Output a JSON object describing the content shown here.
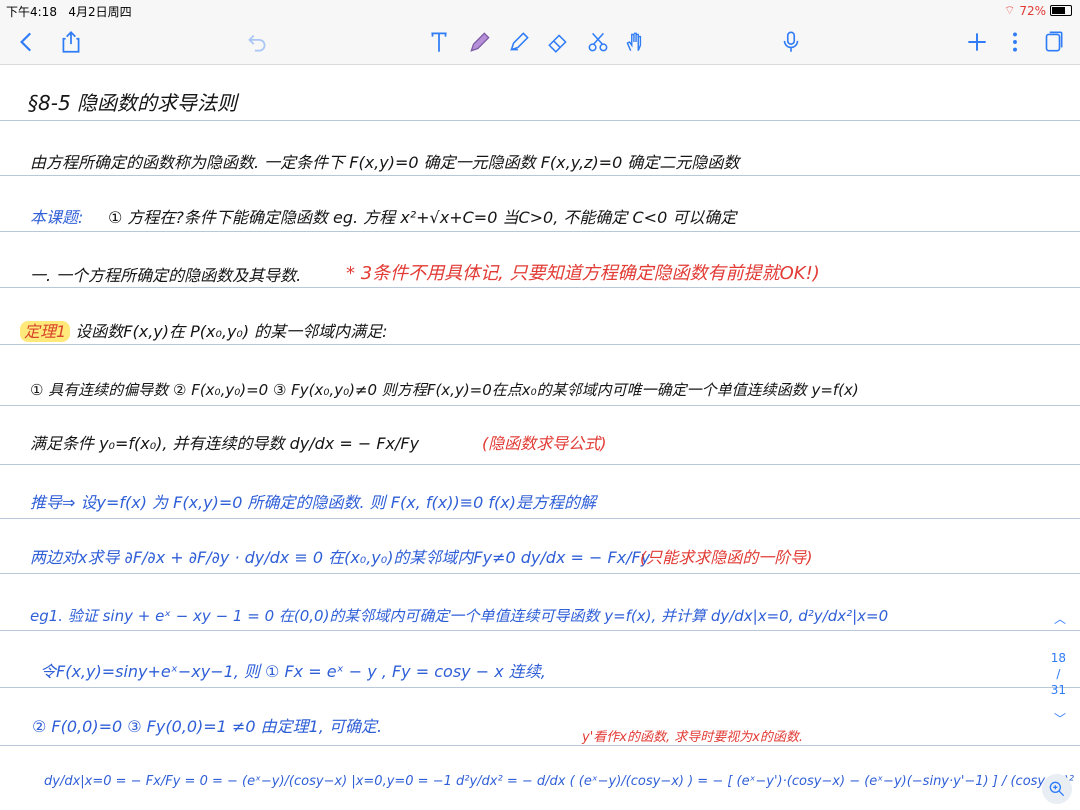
{
  "status": {
    "time": "下午4:18",
    "date": "4月2日周四",
    "battery": "72%",
    "battery_level": 0.72
  },
  "lines": {
    "title": "§8-5 隐函数的求导法则",
    "l1": "由方程所确定的函数称为隐函数. 一定条件下 F(x,y)=0 确定一元隐函数   F(x,y,z)=0 确定二元隐函数",
    "l2_label": "本课题:",
    "l2": "① 方程在?条件下能确定隐函数    eg. 方程 x²+√x+C=0    当C>0, 不能确定   C<0  可以确定",
    "l3": "一. 一个方程所确定的隐函数及其导数.",
    "l3_note": "* 3条件不用具体记, 只要知道方程确定隐函数有前提就OK!)",
    "l4_badge": "定理1",
    "l4": "设函数F(x,y)在 P(x₀,y₀) 的某一邻域内满足:",
    "l5": "① 具有连续的偏导数   ② F(x₀,y₀)=0   ③ Fy(x₀,y₀)≠0   则方程F(x,y)=0在点x₀的某邻域内可唯一确定一个单值连续函数 y=f(x)",
    "l6": "满足条件 y₀=f(x₀), 并有连续的导数      dy/dx = − Fx/Fy",
    "l6_note": "(隐函数求导公式)",
    "l7": "推导⇒    设y=f(x) 为 F(x,y)=0 所确定的隐函数.  则 F(x, f(x))≡0       f(x)是方程的解",
    "l8": "两边对x求导     ∂F/∂x + ∂F/∂y · dy/dx ≡ 0     在(x₀,y₀)的某邻域内Fy≠0     dy/dx = − Fx/Fy",
    "l8_note": "(只能求求隐函的一阶导)",
    "l9": "eg1.  验证 siny + eˣ − xy − 1 = 0 在(0,0)的某邻域内可确定一个单值连续可导函数 y=f(x), 并计算 dy/dx|x=0,  d²y/dx²|x=0",
    "l10": "令F(x,y)=siny+eˣ−xy−1, 则 ① Fx = eˣ − y ,  Fy = cosy − x   连续,",
    "l11": "② F(0,0)=0     ③ Fy(0,0)=1 ≠0         由定理1, 可确定.",
    "l11_note": "y'看作x的函数, 求导时要视为x的函数.",
    "l12": "dy/dx|x=0 = − Fx/Fy = 0 = − (eˣ−y)/(cosy−x) |x=0,y=0 = −1         d²y/dx² = − d/dx ( (eˣ−y)/(cosy−x) ) = − [ (eˣ−y')·(cosy−x) − (eˣ−y)(−siny·y'−1) ] / (cosy−x)²"
  },
  "pager": {
    "current": "18",
    "sep": "/",
    "total": "31"
  },
  "colors": {
    "accent": "#2f7cf6",
    "blue_ink": "#2f5fd7",
    "red_ink": "#e23b35",
    "highlight": "#ffe97a"
  }
}
